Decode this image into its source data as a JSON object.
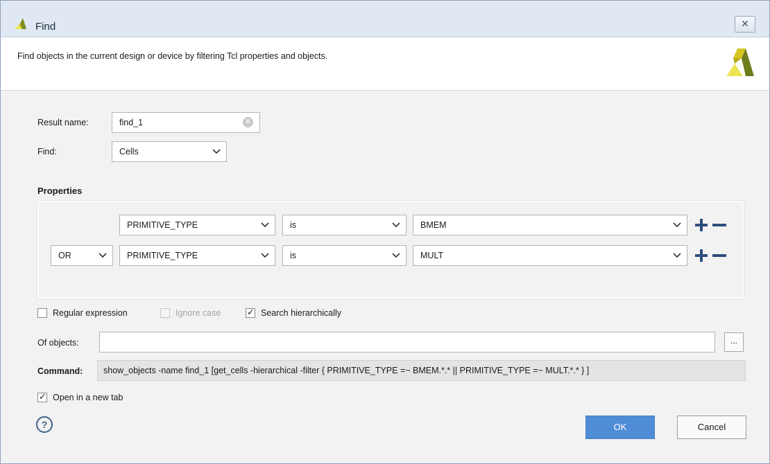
{
  "window": {
    "title": "Find",
    "close_icon": "close-icon",
    "description": "Find objects in the current design or device by filtering Tcl properties and objects."
  },
  "form": {
    "result_name_label": "Result name:",
    "result_name_value": "find_1",
    "find_label": "Find:",
    "find_value": "Cells"
  },
  "properties": {
    "title": "Properties",
    "rows": [
      {
        "operator": "",
        "property": "PRIMITIVE_TYPE",
        "condition": "is",
        "value": "BMEM"
      },
      {
        "operator": "OR",
        "property": "PRIMITIVE_TYPE",
        "condition": "is",
        "value": "MULT"
      }
    ]
  },
  "options": {
    "regular_expression": {
      "label": "Regular expression",
      "checked": false
    },
    "ignore_case": {
      "label": "Ignore case",
      "checked": false,
      "disabled": true
    },
    "search_hierarchically": {
      "label": "Search hierarchically",
      "checked": true
    }
  },
  "objects": {
    "label": "Of objects:",
    "value": "",
    "browse_label": "..."
  },
  "command": {
    "label": "Command:",
    "text": "show_objects -name find_1 [get_cells -hierarchical -filter { PRIMITIVE_TYPE =~ BMEM.*.* || PRIMITIVE_TYPE =~ MULT.*.* } ]"
  },
  "open_new_tab": {
    "label": "Open in a new tab",
    "checked": true
  },
  "buttons": {
    "help": "?",
    "ok": "OK",
    "cancel": "Cancel"
  },
  "colors": {
    "accent": "#4f8dd7",
    "brand_yellow": "#d2c421",
    "brand_dark": "#6e7b1d",
    "brand_light": "#e7df4f"
  }
}
